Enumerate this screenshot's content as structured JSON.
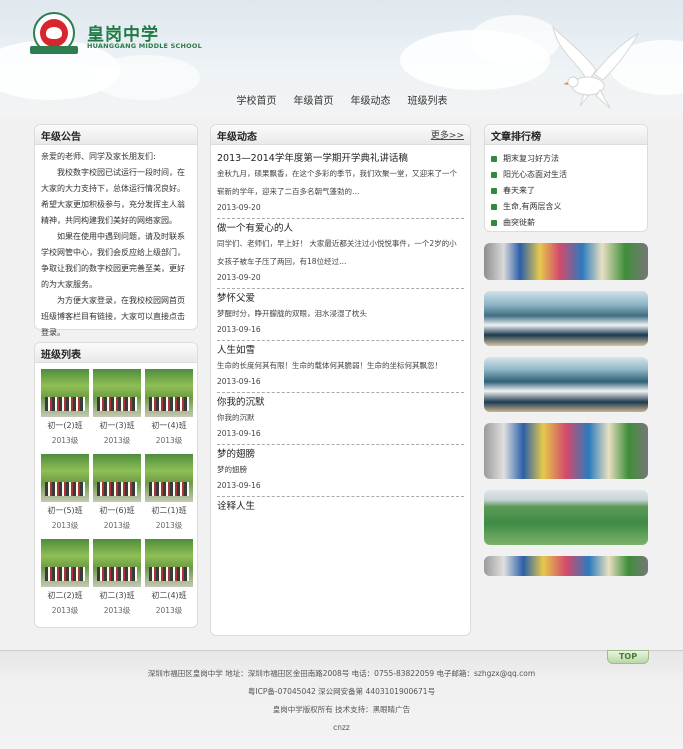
{
  "header": {
    "logo_title": "皇岗中学",
    "logo_sub": "HUANGGANG MIDDLE SCHOOL",
    "nav": [
      "学校首页",
      "年级首页",
      "年级动态",
      "班级列表"
    ]
  },
  "notice": {
    "title": "年级公告",
    "paragraphs": [
      "亲爱的老师、同学及家长朋友们:",
      "我校数字校园已试运行一段时间，在大家的大力支持下，总体运行情况良好。",
      "希望大家更加积极参与，充分发挥主人翁精神，共同构建我们美好的网络家园。",
      "如果在使用中遇到问题，请及时联系学校网管中心，我们会反应给上级部门，争取让我们的数字校园更完善至美，更好的为大家服务。",
      "为方便大家登录，在我校校园网首页班级博客栏目有链接，大家可以直接点击登录。"
    ]
  },
  "classes": {
    "title": "班级列表",
    "items": [
      {
        "name": "初一(2)班",
        "year": "2013级"
      },
      {
        "name": "初一(3)班",
        "year": "2013级"
      },
      {
        "name": "初一(4)班",
        "year": "2013级"
      },
      {
        "name": "初一(5)班",
        "year": "2013级"
      },
      {
        "name": "初一(6)班",
        "year": "2013级"
      },
      {
        "name": "初二(1)班",
        "year": "2013级"
      },
      {
        "name": "初二(2)班",
        "year": "2013级"
      },
      {
        "name": "初二(3)班",
        "year": "2013级"
      },
      {
        "name": "初二(4)班",
        "year": "2013级"
      }
    ]
  },
  "news": {
    "title": "年级动态",
    "more": "更多>>",
    "items": [
      {
        "title": "2013—2014学年度第一学期开学典礼讲话稿",
        "desc": "金秋九月，硕果飘香，在这个多彩的季节，我们欢聚一堂，又迎来了一个崭新的学年，迎来了二百多名朝气蓬勃的…",
        "date": "2013-09-20"
      },
      {
        "title": "做一个有爱心的人",
        "desc": "同学们、老师们，早上好！ 大家最近都关注过小悦悦事件，一个2岁的小女孩子被车子压了两回，有18位经过…",
        "date": "2013-09-20"
      },
      {
        "title": "梦怀父爱",
        "desc": "梦醒时分，睁开朦胧的双眼，泪水浸湿了枕头",
        "date": "2013-09-16"
      },
      {
        "title": "人生如雪",
        "desc": "生命的长度何其有限！生命的载体何其脆弱！生命的坐标何其飘忽！",
        "date": "2013-09-16"
      },
      {
        "title": "你我的沉默",
        "desc": "你我的沉默",
        "date": "2013-09-16"
      },
      {
        "title": "梦的翅膀",
        "desc": "梦的翅膀",
        "date": "2013-09-16"
      },
      {
        "title": "诠释人生",
        "desc": "",
        "date": ""
      }
    ]
  },
  "rank": {
    "title": "文章排行榜",
    "items": [
      "期末复习好方法",
      "阳光心态面对生活",
      "春天来了",
      "生命,有两层含义",
      "曲突徙薪"
    ]
  },
  "footer": {
    "line1": "深圳市福田区皇岗中学  地址：深圳市福田区金田南路2008号  电话：0755-83822059  电子邮箱：szhgzx@qq.com",
    "line2": "粤ICP备-07045042  深公网安备第 4403101900671号",
    "line3": "皇岗中学版权所有  技术支持：黑眼睛广告",
    "line4": "cnzz",
    "top": "TOP"
  },
  "colors": {
    "brand_green": "#1f7a44",
    "accent_red": "#d8262d"
  }
}
